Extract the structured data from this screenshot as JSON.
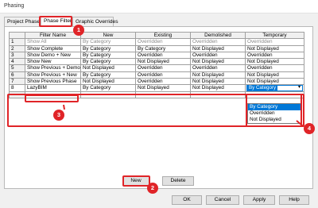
{
  "window": {
    "title": "Phasing"
  },
  "tabs": [
    {
      "label": "Project Phases"
    },
    {
      "label": "Phase Filters"
    },
    {
      "label": "Graphic Overrides"
    }
  ],
  "table": {
    "columns": [
      "",
      "Filter Name",
      "New",
      "Existing",
      "Demolished",
      "Temporary"
    ],
    "rows": [
      {
        "num": "1",
        "name": "Show All",
        "new": "By Category",
        "existing": "Overridden",
        "demolished": "Overridden",
        "temporary": "Overridden"
      },
      {
        "num": "2",
        "name": "Show Complete",
        "new": "By Category",
        "existing": "By Category",
        "demolished": "Not Displayed",
        "temporary": "Not Displayed"
      },
      {
        "num": "3",
        "name": "Show Demo + New",
        "new": "By Category",
        "existing": "Overridden",
        "demolished": "Overridden",
        "temporary": "Overridden"
      },
      {
        "num": "4",
        "name": "Show New",
        "new": "By Category",
        "existing": "Not Displayed",
        "demolished": "Not Displayed",
        "temporary": "Not Displayed"
      },
      {
        "num": "5",
        "name": "Show Previous + Demo",
        "new": "Not Displayed",
        "existing": "Overridden",
        "demolished": "Overridden",
        "temporary": "Overridden"
      },
      {
        "num": "6",
        "name": "Show Previous + New",
        "new": "By Category",
        "existing": "Overridden",
        "demolished": "Not Displayed",
        "temporary": "Not Displayed"
      },
      {
        "num": "7",
        "name": "Show Previous Phase",
        "new": "Not Displayed",
        "existing": "Overridden",
        "demolished": "Not Displayed",
        "temporary": "Not Displayed"
      },
      {
        "num": "8",
        "name": "LazyBIM",
        "new": "By Category",
        "existing": "Not Displayed",
        "demolished": "Not Displayed",
        "temporary": "By Category"
      }
    ]
  },
  "dropdown": {
    "selected": "By Category",
    "options": [
      "By Category",
      "Overridden",
      "Not Displayed"
    ]
  },
  "buttons": {
    "new": "New",
    "delete": "Delete",
    "ok": "OK",
    "cancel": "Cancel",
    "apply": "Apply",
    "help": "Help"
  },
  "callouts": [
    "1",
    "2",
    "3",
    "4"
  ],
  "colors": {
    "callout": "#e02428",
    "selection": "#0078d7"
  }
}
